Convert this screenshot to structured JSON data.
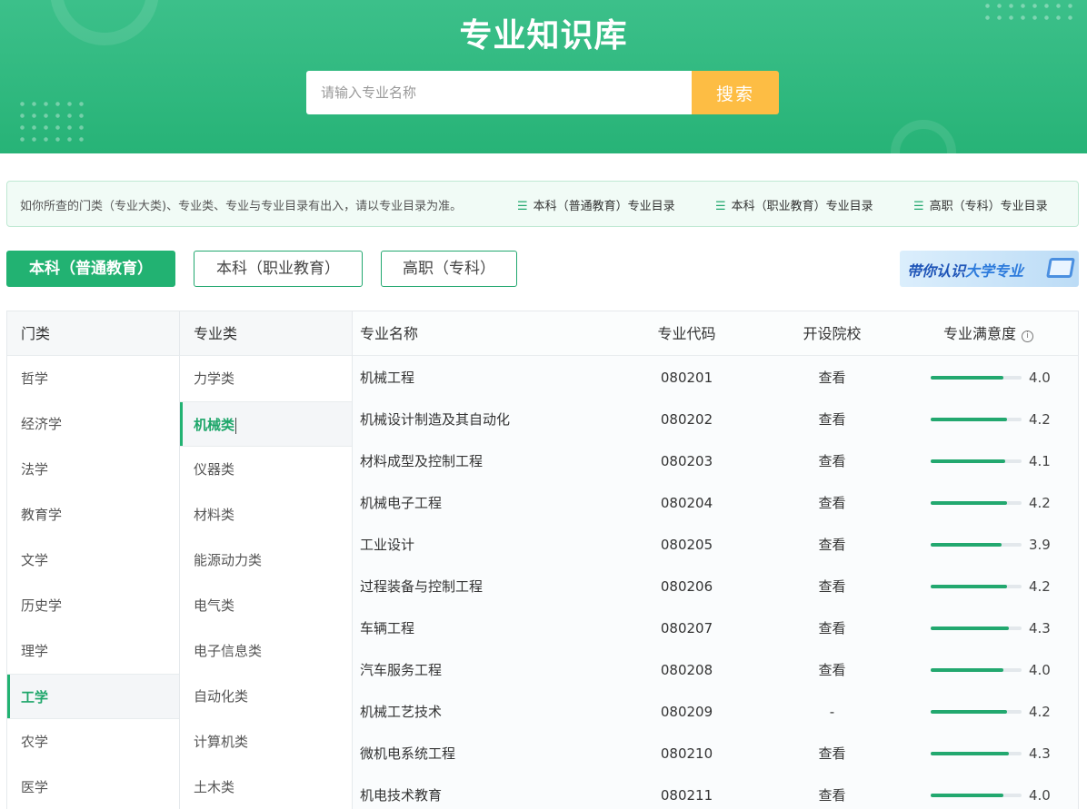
{
  "header": {
    "title": "专业知识库",
    "search_placeholder": "请输入专业名称",
    "search_button": "搜索"
  },
  "notice": {
    "text": "如你所查的门类（专业大类)、专业类、专业与专业目录有出入，请以专业目录为准。",
    "links": [
      {
        "icon": "list-icon",
        "label": "本科（普通教育）专业目录"
      },
      {
        "icon": "list-icon",
        "label": "本科（职业教育）专业目录"
      },
      {
        "icon": "list-icon",
        "label": "高职（专科）专业目录"
      }
    ]
  },
  "category_tabs": [
    {
      "label": "本科（普通教育）",
      "active": true
    },
    {
      "label": "本科（职业教育）",
      "active": false
    },
    {
      "label": "高职（专科）",
      "active": false
    }
  ],
  "promo": {
    "text_a": "带你认识",
    "text_b": "大学专业"
  },
  "colors": {
    "brand_green": "#22b272",
    "search_button": "#fdbd44",
    "bar_fill": "#22a86f"
  },
  "menlei": {
    "header": "门类",
    "items": [
      "哲学",
      "经济学",
      "法学",
      "教育学",
      "文学",
      "历史学",
      "理学",
      "工学",
      "农学",
      "医学"
    ],
    "selected": "工学"
  },
  "zhuanyelei": {
    "header": "专业类",
    "items": [
      "力学类",
      "机械类",
      "仪器类",
      "材料类",
      "能源动力类",
      "电气类",
      "电子信息类",
      "自动化类",
      "计算机类",
      "土木类"
    ],
    "selected": "机械类"
  },
  "table": {
    "headers": {
      "name": "专业名称",
      "code": "专业代码",
      "school": "开设院校",
      "satisfaction": "专业满意度"
    },
    "rows": [
      {
        "name": "机械工程",
        "code": "080201",
        "school": "查看",
        "score": "4.0"
      },
      {
        "name": "机械设计制造及其自动化",
        "code": "080202",
        "school": "查看",
        "score": "4.2"
      },
      {
        "name": "材料成型及控制工程",
        "code": "080203",
        "school": "查看",
        "score": "4.1"
      },
      {
        "name": "机械电子工程",
        "code": "080204",
        "school": "查看",
        "score": "4.2"
      },
      {
        "name": "工业设计",
        "code": "080205",
        "school": "查看",
        "score": "3.9"
      },
      {
        "name": "过程装备与控制工程",
        "code": "080206",
        "school": "查看",
        "score": "4.2"
      },
      {
        "name": "车辆工程",
        "code": "080207",
        "school": "查看",
        "score": "4.3"
      },
      {
        "name": "汽车服务工程",
        "code": "080208",
        "school": "查看",
        "score": "4.0"
      },
      {
        "name": "机械工艺技术",
        "code": "080209",
        "school": "-",
        "score": "4.2"
      },
      {
        "name": "微机电系统工程",
        "code": "080210",
        "school": "查看",
        "score": "4.3"
      },
      {
        "name": "机电技术教育",
        "code": "080211",
        "school": "查看",
        "score": "4.0"
      }
    ]
  }
}
